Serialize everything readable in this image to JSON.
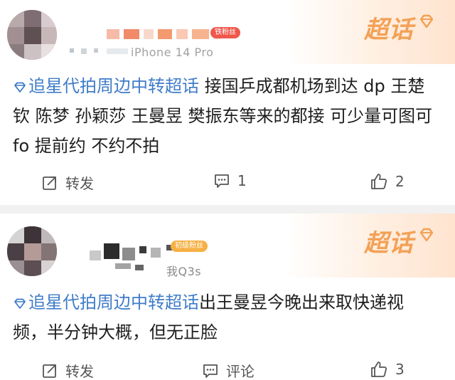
{
  "colors": {
    "topic": "#3f7cc9",
    "super_logo": "#f3a156",
    "badge1": "#f0574b",
    "badge2": "#f6b043"
  },
  "posts": [
    {
      "badge": "铁粉丝",
      "source": "iPhone 14 Pro",
      "super_label": "超话",
      "topic": "追星代拍周边中转超话",
      "content_lines": [
        " 接国乒成都机场到达 dp 王楚",
        "钦 陈梦 孙颖莎 王曼昱 樊振东等来的都接 可少量可图可",
        "fo 提前约 不约不拍"
      ],
      "actions": {
        "repost": "转发",
        "comment": "1",
        "like": "2"
      }
    },
    {
      "badge": "初级粉丝",
      "source": "我Q3s",
      "super_label": "超话",
      "topic": "追星代拍周边中转超话",
      "content_lines": [
        "出王曼昱今晚出来取快递视",
        "频，半分钟大概，但无正脸"
      ],
      "actions": {
        "repost": "转发",
        "comment": "评论",
        "like": "3"
      }
    }
  ]
}
